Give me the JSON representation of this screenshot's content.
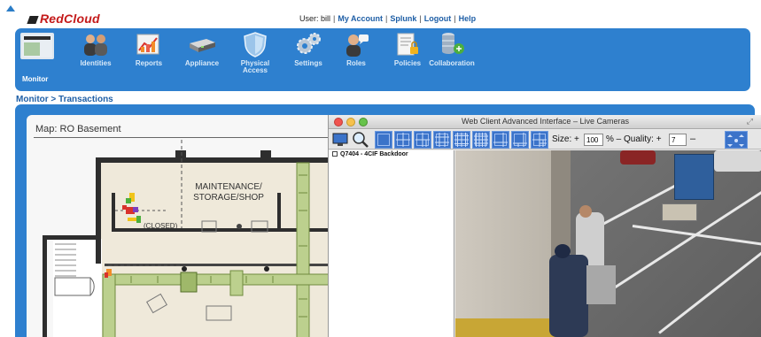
{
  "app": {
    "brand": "RedCloud"
  },
  "header": {
    "user_prefix": "User: bill",
    "links": [
      "My Account",
      "Splunk",
      "Logout",
      "Help"
    ]
  },
  "nav": {
    "items": [
      {
        "label": "Monitor",
        "icon": "monitor-icon",
        "active": true
      },
      {
        "label": "Identities",
        "icon": "identities-icon"
      },
      {
        "label": "Reports",
        "icon": "reports-icon"
      },
      {
        "label": "Appliance",
        "icon": "appliance-icon"
      },
      {
        "label": "Physical Access",
        "icon": "shield-icon"
      },
      {
        "label": "Settings",
        "icon": "gear-icon"
      },
      {
        "label": "Roles",
        "icon": "roles-icon"
      },
      {
        "label": "Policies",
        "icon": "policies-icon"
      },
      {
        "label": "Collaboration",
        "icon": "collaboration-icon"
      }
    ]
  },
  "breadcrumb": "Monitor > Transactions",
  "map": {
    "title": "Map: RO Basement",
    "room_label": "MAINTENANCE/\nSTORAGE/SHOP",
    "closed_label": "(CLOSED)"
  },
  "camera_window": {
    "title": "Web Client Advanced Interface – Live Cameras",
    "size_label": "Size: +",
    "size_value": "100",
    "percent_label": "% –  Quality: +",
    "quality_value": "7",
    "quality_minus": "–",
    "camera_list": [
      {
        "label": "Q7404 - 4CIF Backdoor"
      }
    ]
  },
  "colors": {
    "brand_red": "#c41a1a",
    "nav_blue": "#2e80cf",
    "link_blue": "#1f5fa6"
  }
}
